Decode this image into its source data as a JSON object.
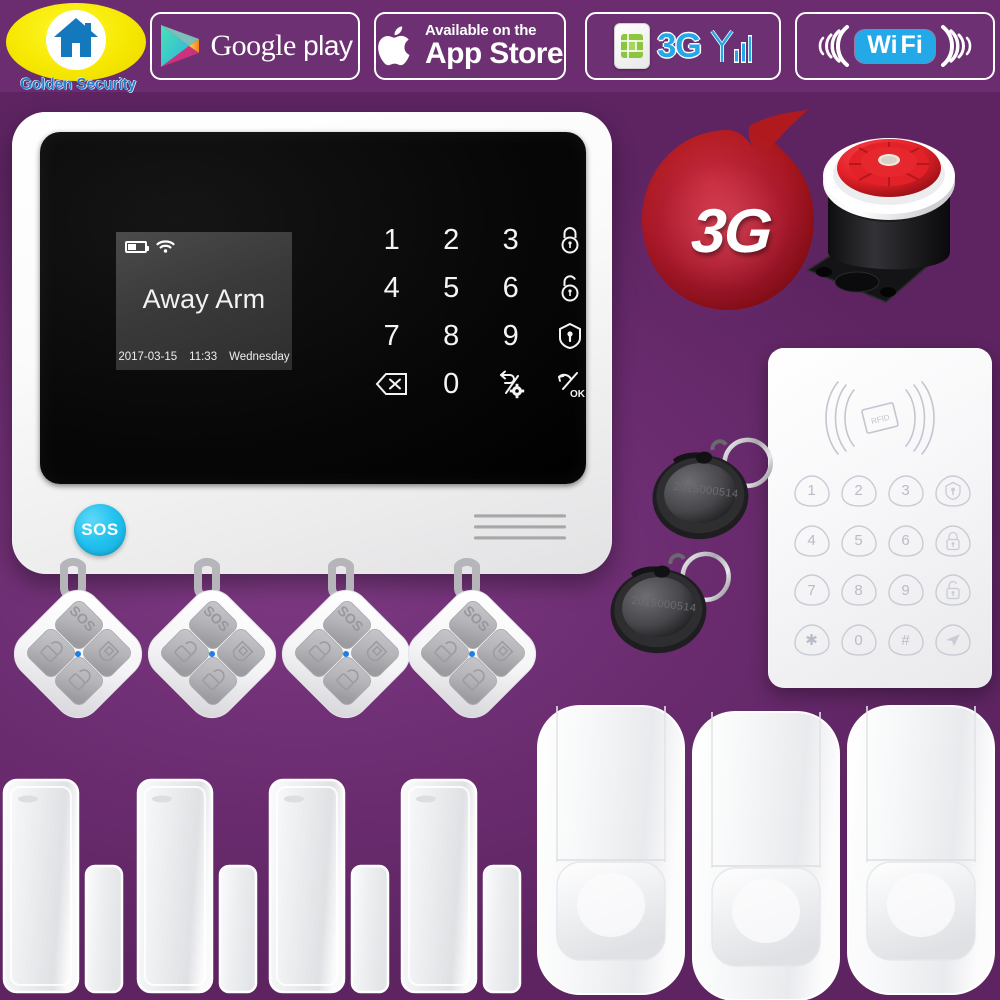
{
  "header": {
    "logo": {
      "brand": "Golden Security",
      "icon": "house-icon"
    },
    "badges": [
      {
        "id": "google-play",
        "line1": "Google",
        "line2": "play",
        "icon": "google-play-triangle-icon"
      },
      {
        "id": "app-store",
        "line1": "Available on the",
        "line2": "App Store",
        "icon": "apple-logo-icon"
      },
      {
        "id": "network-3g",
        "label": "3G",
        "icon_sim": "sim-card-icon",
        "icon_signal": "signal-bars-icon"
      },
      {
        "id": "wifi",
        "label_1": "Wi",
        "label_2": "Fi",
        "icon": "wifi-waves-icon"
      }
    ]
  },
  "panel": {
    "lcd": {
      "status": "Away Arm",
      "date": "2017-03-15",
      "time": "11:33",
      "weekday": "Wednesday",
      "battery_icon": "battery-icon",
      "wifi_icon": "wifi-icon"
    },
    "keypad": [
      {
        "label": "1",
        "name": "key-1",
        "type": "digit"
      },
      {
        "label": "2",
        "name": "key-2",
        "type": "digit"
      },
      {
        "label": "3",
        "name": "key-3",
        "type": "digit"
      },
      {
        "label": "",
        "name": "key-arm-away",
        "type": "icon",
        "icon": "lock-closed-icon"
      },
      {
        "label": "4",
        "name": "key-4",
        "type": "digit"
      },
      {
        "label": "5",
        "name": "key-5",
        "type": "digit"
      },
      {
        "label": "6",
        "name": "key-6",
        "type": "digit"
      },
      {
        "label": "",
        "name": "key-disarm",
        "type": "icon",
        "icon": "lock-open-icon"
      },
      {
        "label": "7",
        "name": "key-7",
        "type": "digit"
      },
      {
        "label": "8",
        "name": "key-8",
        "type": "digit"
      },
      {
        "label": "9",
        "name": "key-9",
        "type": "digit"
      },
      {
        "label": "",
        "name": "key-arm-home",
        "type": "icon",
        "icon": "home-shield-icon"
      },
      {
        "label": "",
        "name": "key-delete",
        "type": "icon",
        "icon": "backspace-icon"
      },
      {
        "label": "0",
        "name": "key-0",
        "type": "digit"
      },
      {
        "label": "",
        "name": "key-settings",
        "type": "icon",
        "icon": "gear-arrow-icon"
      },
      {
        "label": "",
        "name": "key-ok",
        "type": "icon",
        "icon": "ok-icon"
      }
    ],
    "sos_label": "SOS",
    "speaker_lines": 3
  },
  "badge_3g": {
    "label": "3G",
    "shape": "teardrop-comma",
    "color": "#b01a1f"
  },
  "siren": {
    "name": "wired-siren",
    "horn_color": "#e32128",
    "body_color": "#1c1c1e"
  },
  "rfid_keypad": {
    "antenna_label": "RFID",
    "keys": [
      {
        "label": "1",
        "name": "rfid-key-1",
        "type": "digit"
      },
      {
        "label": "2",
        "name": "rfid-key-2",
        "type": "digit"
      },
      {
        "label": "3",
        "name": "rfid-key-3",
        "type": "digit"
      },
      {
        "label": "",
        "name": "rfid-key-arm-home",
        "type": "icon",
        "icon": "home-shield-icon"
      },
      {
        "label": "4",
        "name": "rfid-key-4",
        "type": "digit"
      },
      {
        "label": "5",
        "name": "rfid-key-5",
        "type": "digit"
      },
      {
        "label": "6",
        "name": "rfid-key-6",
        "type": "digit"
      },
      {
        "label": "",
        "name": "rfid-key-arm-away",
        "type": "icon",
        "icon": "lock-closed-icon"
      },
      {
        "label": "7",
        "name": "rfid-key-7",
        "type": "digit"
      },
      {
        "label": "8",
        "name": "rfid-key-8",
        "type": "digit"
      },
      {
        "label": "9",
        "name": "rfid-key-9",
        "type": "digit"
      },
      {
        "label": "",
        "name": "rfid-key-disarm",
        "type": "icon",
        "icon": "lock-open-icon"
      },
      {
        "label": "✱",
        "name": "rfid-key-star",
        "type": "digit"
      },
      {
        "label": "0",
        "name": "rfid-key-0",
        "type": "digit"
      },
      {
        "label": "#",
        "name": "rfid-key-hash",
        "type": "digit"
      },
      {
        "label": "",
        "name": "rfid-key-send",
        "type": "icon",
        "icon": "send-arrow-icon"
      }
    ]
  },
  "rfid_tags": [
    {
      "code": "2015000514",
      "name": "rfid-tag"
    },
    {
      "code": "2015000514",
      "name": "rfid-tag"
    }
  ],
  "remotes": [
    {
      "name": "remote-control",
      "sos": "SOS",
      "buttons": [
        "sos",
        "disarm",
        "arm-home",
        "arm-away"
      ]
    },
    {
      "name": "remote-control",
      "sos": "SOS",
      "buttons": [
        "sos",
        "disarm",
        "arm-home",
        "arm-away"
      ]
    },
    {
      "name": "remote-control",
      "sos": "SOS",
      "buttons": [
        "sos",
        "disarm",
        "arm-home",
        "arm-away"
      ]
    },
    {
      "name": "remote-control",
      "sos": "SOS",
      "buttons": [
        "sos",
        "disarm",
        "arm-home",
        "arm-away"
      ]
    }
  ],
  "door_sensors": [
    {
      "name": "door-window-sensor"
    },
    {
      "name": "door-window-sensor"
    },
    {
      "name": "door-window-sensor"
    },
    {
      "name": "door-window-sensor"
    }
  ],
  "pir_detectors": [
    {
      "name": "pir-motion-detector"
    },
    {
      "name": "pir-motion-detector"
    },
    {
      "name": "pir-motion-detector"
    }
  ],
  "colors": {
    "background_purple": "#6b2c70",
    "accent_cyan": "#24c3ef",
    "brand_yellow": "#f6e800",
    "brand_blue": "#1e7ec8",
    "red_3g": "#b01a1f"
  }
}
